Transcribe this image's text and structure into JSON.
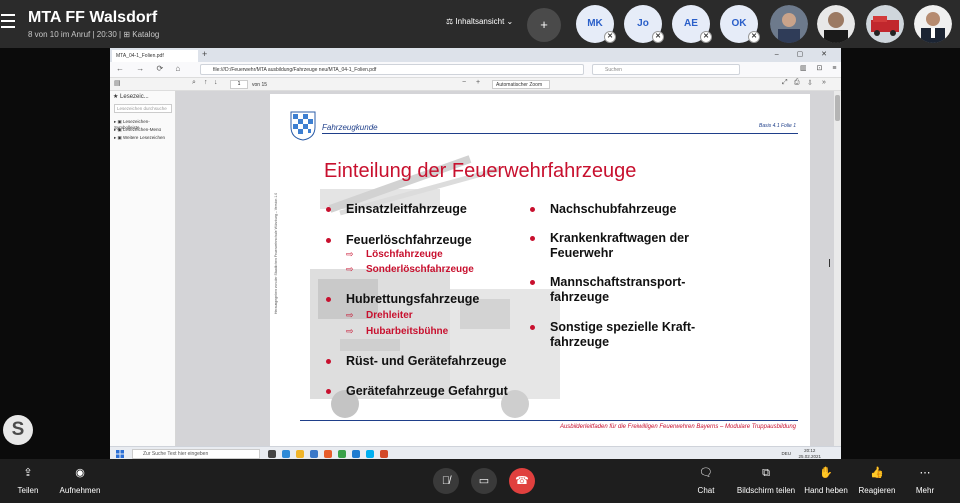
{
  "call": {
    "title": "MTA  FF Walsdorf",
    "subtitle": "8 von 10 im Anruf | 20:30 | ⊞ Katalog",
    "content_view": "Inhaltsansicht ⌄",
    "participants": [
      "MK",
      "Jo",
      "AE",
      "OK"
    ]
  },
  "browser": {
    "tab_title": "MTA_04-1_Folien.pdf",
    "url": "file:///D:/Feuerwehr/MTA ausbildung/Fahrzeuge neu/MTA_04-1_Folien.pdf",
    "search_placeholder": "Suchen"
  },
  "pdf": {
    "page": "1",
    "page_count": "von 15",
    "zoom": "Automatischer Zoom"
  },
  "sidebar": {
    "title": "Lesezeic...",
    "search_placeholder": "Lesezeichen durchsuche",
    "items": [
      "Lesezeichen-Symbolleiste",
      "Lesezeichen-Menü",
      "Weitere Lesezeichen"
    ]
  },
  "slide": {
    "header_name": "Fahrzeugkunde",
    "header_ref": "Basis 4.1 Folie 1",
    "title": "Einteilung der Feuerwehrfahrzeuge",
    "vertical_note": "Herausgegeben von der Staatlichen Feuerwehrschule Würzburg – Version 1.0",
    "left": [
      {
        "label": "Einsatzleitfahrzeuge",
        "subs": []
      },
      {
        "label": "Feuerlöschfahrzeuge",
        "subs": [
          "Löschfahrzeuge",
          "Sonderlöschfahrzeuge"
        ]
      },
      {
        "label": "Hubrettungsfahrzeuge",
        "subs": [
          "Drehleiter",
          "Hubarbeitsbühne"
        ]
      },
      {
        "label": "Rüst- und Gerätefahrzeuge",
        "subs": []
      },
      {
        "label": "Gerätefahrzeuge Gefahrgut",
        "subs": []
      }
    ],
    "right": [
      {
        "label": "Nachschubfahrzeuge"
      },
      {
        "label": "Krankenkraftwagen der Feuerwehr"
      },
      {
        "label": "Mannschaftstransport-fahrzeuge"
      },
      {
        "label": "Sonstige spezielle Kraft-fahrzeuge"
      }
    ],
    "footer": "Ausbilderleitfaden für die Freiwilligen Feuerwehren Bayerns – Modulare Truppausbildung"
  },
  "taskbar": {
    "search": "Zur Suche Text hier eingeben",
    "lang": "DEU",
    "time": "20:12",
    "date": "25.02.2021"
  },
  "controls": {
    "share": "Teilen",
    "record": "Aufnehmen",
    "chat": "Chat",
    "screen_share": "Bildschirm teilen",
    "raise_hand": "Hand heben",
    "react": "Reagieren",
    "more": "Mehr"
  },
  "colors": {
    "accent_red": "#c8102e",
    "header_blue": "#1f3f8a",
    "hangup": "#e0403e"
  }
}
